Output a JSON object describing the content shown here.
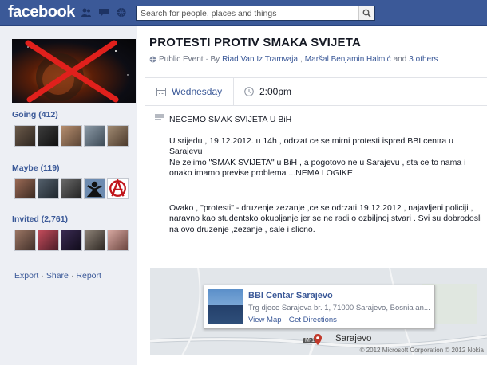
{
  "topbar": {
    "logo": "facebook",
    "search_placeholder": "Search for people, places and things"
  },
  "sidebar": {
    "going_label": "Going (412)",
    "maybe_label": "Maybe (119)",
    "invited_label": "Invited (2,761)",
    "links": {
      "export": "Export",
      "share": "Share",
      "report": "Report",
      "sep": "·"
    }
  },
  "event": {
    "title": "PROTESTI PROTIV SMAKA SVIJETA",
    "type_prefix": "Public Event · By",
    "host1": "Riad Van Iz Tramvaja",
    "host_sep": ",",
    "host2": "Maršal Benjamin Halmić",
    "and_text": "and",
    "others": "3 others",
    "day": "Wednesday",
    "time": "2:00pm",
    "description": [
      "NECEMO SMAK SVIJETA U BiH",
      "U srijedu , 19.12.2012. u 14h , odrzat ce se mirni protesti ispred BBI centra u Sarajevu",
      "Ne zelimo \"SMAK SVIJETA\" u BiH , a pogotovo ne u Sarajevu , sta ce to nama i onako imamo previse problema ...NEMA LOGIKE",
      "Ovako , \"protesti\" - druzenje zezanje ,ce se odrzati 19.12.2012 , najavljeni policiji , naravno kao studentsko okupljanje jer se ne radi o ozbiljnoj stvari . Svi su dobrodosli na ovo druzenje ,zezanje , sale i slicno."
    ]
  },
  "map": {
    "place_name": "BBI Centar Sarajevo",
    "address": "Trg djece Sarajeva br. 1, 71000 Sarajevo, Bosnia an...",
    "view_map": "View Map",
    "sep": "·",
    "get_directions": "Get Directions",
    "city_label": "Sarajevo",
    "road_label": "M-18",
    "copyright": "© 2012 Microsoft Corporation © 2012 Nokia"
  },
  "colors": {
    "brand": "#3b5998",
    "sidebar_bg": "#edeff4",
    "link": "#3b5998"
  },
  "icons": [
    "friends-icon",
    "messages-icon",
    "globe-icon",
    "search-icon",
    "globe-small-icon",
    "calendar-icon",
    "clock-icon",
    "description-lines-icon",
    "map-pin-icon"
  ]
}
